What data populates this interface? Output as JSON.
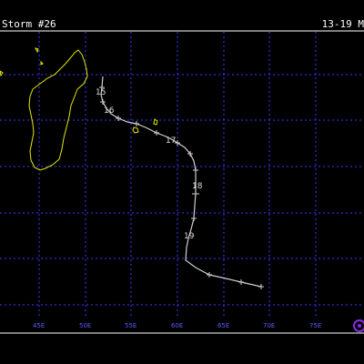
{
  "header": {
    "storm_name": "Storm #26",
    "date_range": "13-19 M"
  },
  "map": {
    "longitude_labels": [
      "45E",
      "50E",
      "55E",
      "60E",
      "65E",
      "70E",
      "75E"
    ],
    "day_labels": [
      "15",
      "16",
      "17",
      "18",
      "19"
    ],
    "colors": {
      "background": "#000000",
      "grid": "#3a3aff",
      "coast": "#e6e600",
      "track": "#cfcfcf",
      "frame": "#ffffff",
      "logo": "#8a2be2"
    },
    "logo_icon": "unisys-logo-icon"
  }
}
